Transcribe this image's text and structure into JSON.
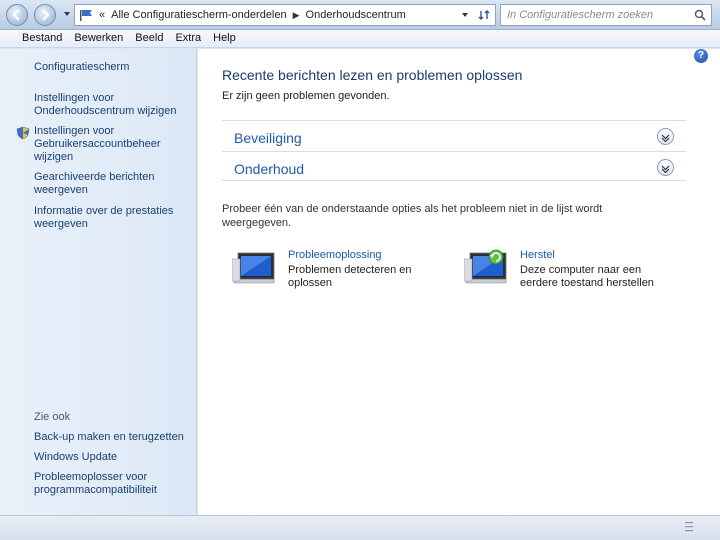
{
  "address": {
    "crumb_prefix": "«",
    "crumbs": [
      "Alle Configuratiescherm-onderdelen",
      "Onderhoudscentrum"
    ],
    "search_placeholder": "In Configuratiescherm zoeken"
  },
  "menu": [
    "Bestand",
    "Bewerken",
    "Beeld",
    "Extra",
    "Help"
  ],
  "left": {
    "home": "Configuratiescherm",
    "links": [
      "Instellingen voor Onderhoudscentrum wijzigen",
      "Instellingen voor Gebruikersaccountbeheer wijzigen",
      "Gearchiveerde berichten weergeven",
      "Informatie over de prestaties weergeven"
    ],
    "see_also": "Zie ook",
    "see_also_links": [
      "Back-up maken en terugzetten",
      "Windows Update",
      "Probleemoplosser voor programmacompatibiliteit"
    ]
  },
  "content": {
    "help": "?",
    "title": "Recente berichten lezen en problemen oplossen",
    "subtitle": "Er zijn geen problemen gevonden.",
    "sections": [
      "Beveiliging",
      "Onderhoud"
    ],
    "hint": "Probeer één van de onderstaande opties als het probleem niet in de lijst wordt weergegeven.",
    "tiles": [
      {
        "title": "Probleemoplossing",
        "desc": "Problemen detecteren en oplossen"
      },
      {
        "title": "Herstel",
        "desc": "Deze computer naar een eerdere toestand herstellen"
      }
    ]
  },
  "colors": {
    "link": "#1f5aa8",
    "title": "#1a3a6e"
  }
}
